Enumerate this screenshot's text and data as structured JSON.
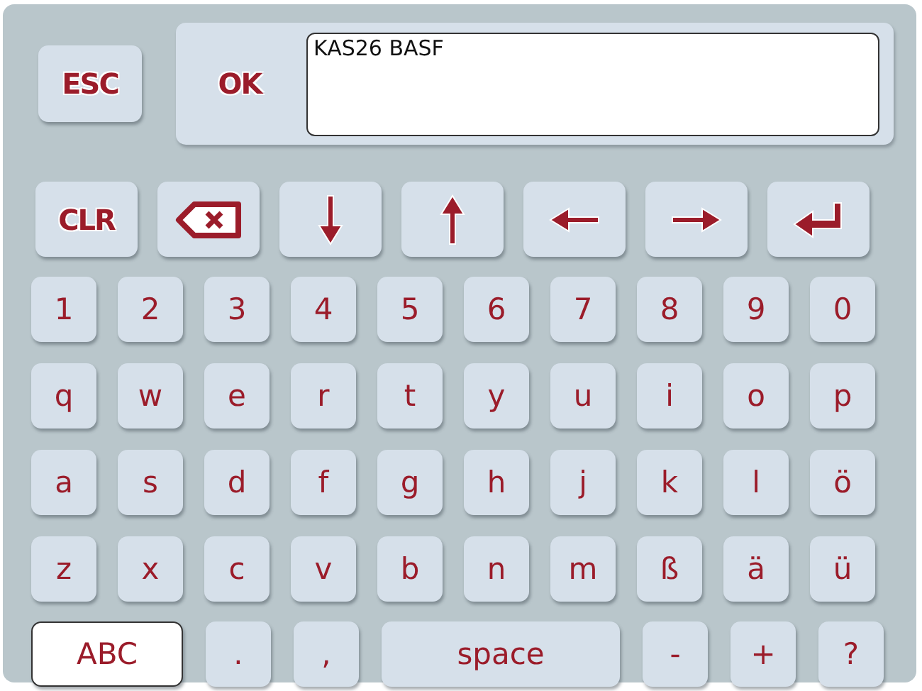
{
  "esc": "ESC",
  "ok": "OK",
  "input": {
    "value": "KAS26 BASF"
  },
  "control_keys": [
    {
      "kind": "text",
      "label": "CLR"
    },
    {
      "kind": "backspace"
    },
    {
      "kind": "down"
    },
    {
      "kind": "up"
    },
    {
      "kind": "left"
    },
    {
      "kind": "right"
    },
    {
      "kind": "enter"
    }
  ],
  "rows": [
    [
      "1",
      "2",
      "3",
      "4",
      "5",
      "6",
      "7",
      "8",
      "9",
      "0"
    ],
    [
      "q",
      "w",
      "e",
      "r",
      "t",
      "y",
      "u",
      "i",
      "o",
      "p"
    ],
    [
      "a",
      "s",
      "d",
      "f",
      "g",
      "h",
      "j",
      "k",
      "l",
      "ö"
    ],
    [
      "z",
      "x",
      "c",
      "v",
      "b",
      "n",
      "m",
      "ß",
      "ä",
      "ü"
    ]
  ],
  "bottom_row": [
    {
      "kind": "mode",
      "label": "ABC",
      "selected": true
    },
    {
      "kind": "char",
      "label": "."
    },
    {
      "kind": "char",
      "label": ","
    },
    {
      "kind": "space",
      "label": "space"
    },
    {
      "kind": "char",
      "label": "-"
    },
    {
      "kind": "char",
      "label": "+"
    },
    {
      "kind": "char",
      "label": "?"
    }
  ]
}
